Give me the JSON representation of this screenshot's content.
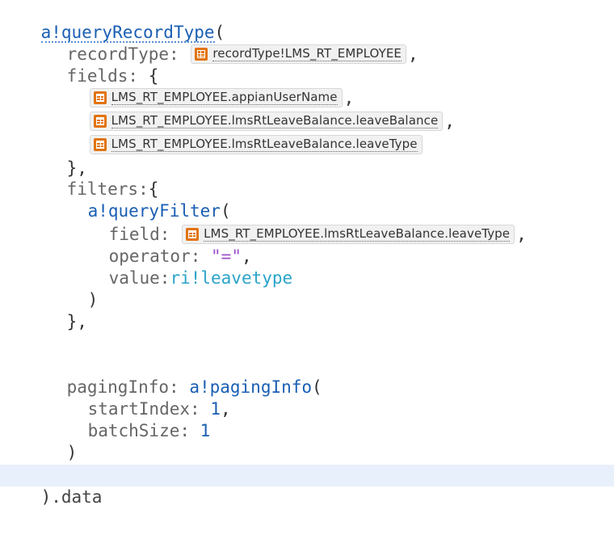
{
  "editor": {
    "lines": {
      "query_fn": "a!queryRecordType",
      "open_paren": "(",
      "record_type_key": "recordType:",
      "record_type_chip": "recordType!LMS_RT_EMPLOYEE",
      "comma": ",",
      "fields_key": "fields:",
      "open_brace": "{",
      "field_1": "LMS_RT_EMPLOYEE.appianUserName",
      "field_2": "LMS_RT_EMPLOYEE.lmsRtLeaveBalance.leaveBalance",
      "field_3": "LMS_RT_EMPLOYEE.lmsRtLeaveBalance.leaveType",
      "close_brace_comma": "},",
      "filters_key": "filters:",
      "query_filter_fn": "a!queryFilter",
      "field_key": "field:",
      "filter_field_chip": "LMS_RT_EMPLOYEE.lmsRtLeaveBalance.leaveType",
      "operator_key": "operator:",
      "operator_value": "\"=\"",
      "value_key": "value:",
      "value_ref": "ri!leavetype",
      "close_paren": ")",
      "paging_key": "pagingInfo:",
      "paging_fn": "a!pagingInfo",
      "start_index_key": "startIndex:",
      "start_index_value": "1",
      "batch_size_key": "batchSize:",
      "batch_size_value": "1",
      "data_suffix": ".data"
    }
  },
  "colors": {
    "function": "#1a5fb4",
    "string": "#9c4fc9",
    "rule_input": "#2aa4c9",
    "chip_icon": "#e2730b",
    "active_line": "#e8f0fb"
  },
  "icons": {
    "record_type": "record-type-icon",
    "field": "record-field-icon"
  }
}
